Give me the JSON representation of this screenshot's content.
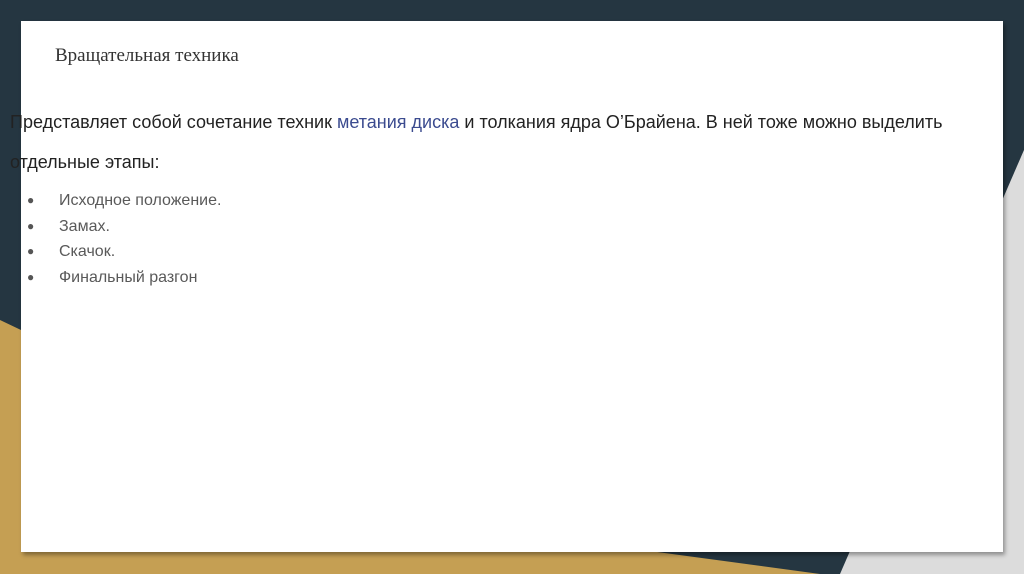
{
  "slide": {
    "title": "Вращательная техника",
    "paragraph": {
      "before": "Представляет собой сочетание техник ",
      "link": "метания диска",
      "after": " и толкания ядра О’Брайена. В ней тоже можно выделить отдельные этапы:"
    },
    "stages": [
      "Исходное положение.",
      "Замах.",
      "Скачок.",
      "Финальный разгон"
    ]
  },
  "colors": {
    "background_dark": "#253641",
    "background_gold": "#c59f53",
    "background_grey": "#dcdcdc",
    "link": "#3b4b8f"
  }
}
